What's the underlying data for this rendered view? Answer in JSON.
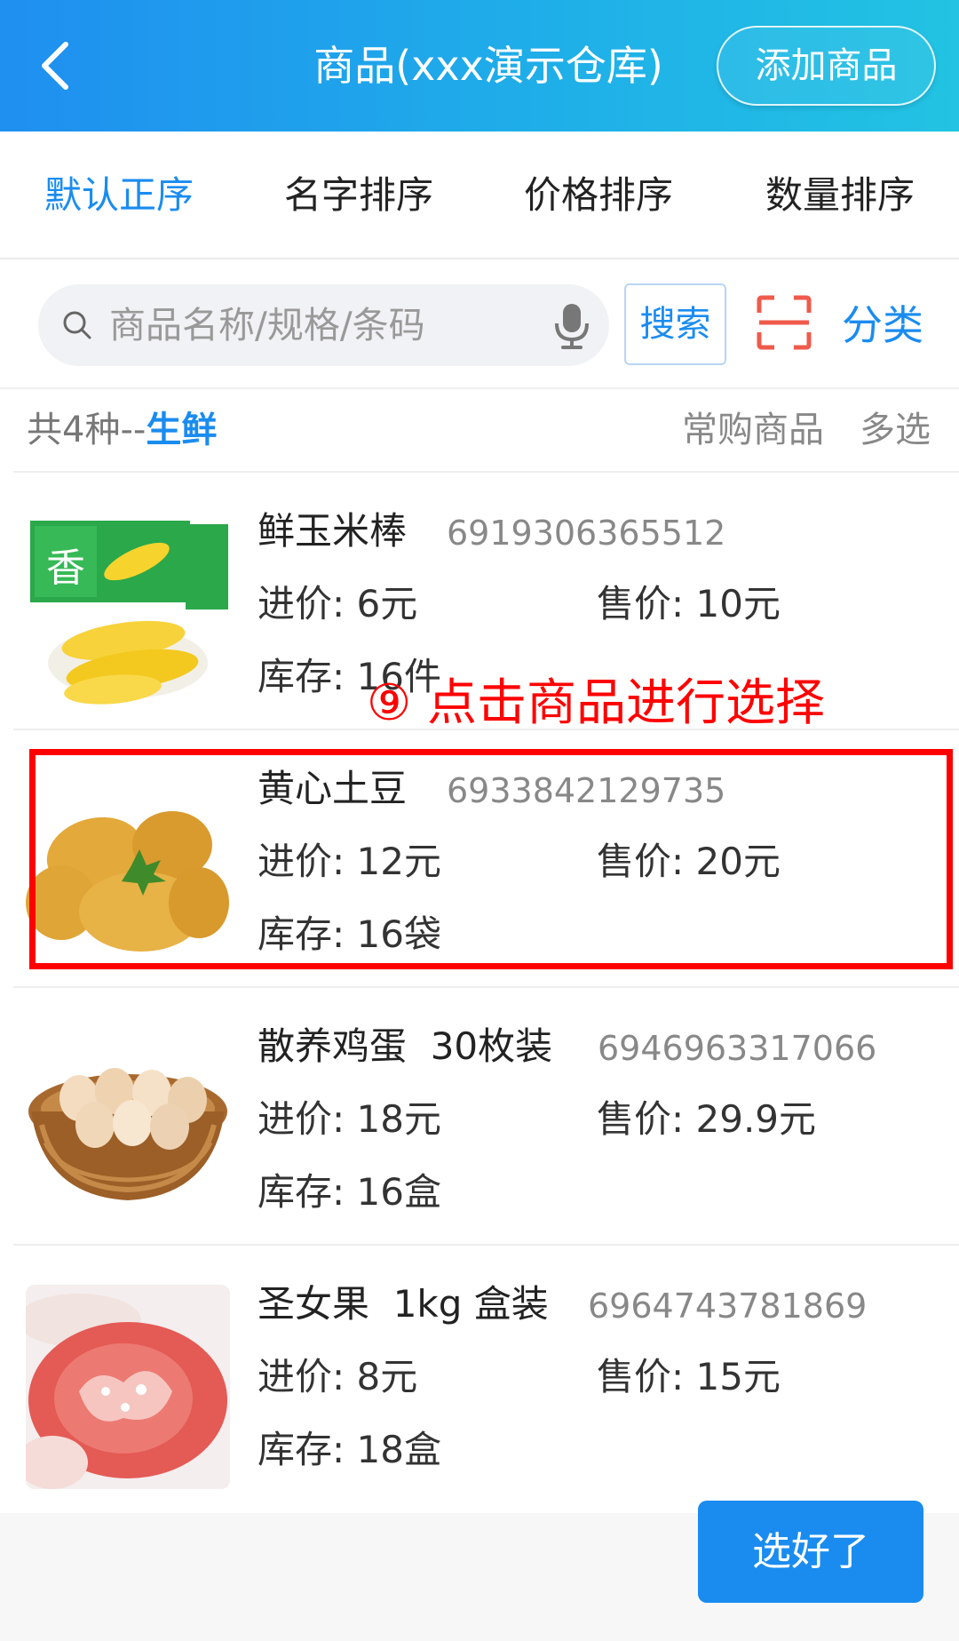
{
  "header": {
    "title": "商品(xxx演示仓库)",
    "add_label": "添加商品",
    "colors": {
      "start": "#1f8ff0",
      "end": "#22c3e3"
    }
  },
  "sort_tabs": [
    {
      "label": "默认正序",
      "active": true
    },
    {
      "label": "名字排序",
      "active": false
    },
    {
      "label": "价格排序",
      "active": false
    },
    {
      "label": "数量排序",
      "active": false
    }
  ],
  "search": {
    "placeholder": "商品名称/规格/条码",
    "button_label": "搜索",
    "category_label": "分类"
  },
  "info": {
    "count_text": "共4种--",
    "category": "生鲜",
    "frequent_label": "常购商品",
    "multi_label": "多选"
  },
  "products": [
    {
      "name": "鲜玉米棒",
      "code": "6919306365512",
      "buy": "进价: 6元",
      "sell": "售价: 10元",
      "stock": "库存: 16件",
      "image": "corn-image"
    },
    {
      "name": "黄心土豆",
      "code": "6933842129735",
      "buy": "进价: 12元",
      "sell": "售价: 20元",
      "stock": "库存: 16袋",
      "image": "potato-image"
    },
    {
      "name": "散养鸡蛋  30枚装",
      "code": "6946963317066",
      "buy": "进价: 18元",
      "sell": "售价: 29.9元",
      "stock": "库存: 16盒",
      "image": "eggs-image"
    },
    {
      "name": "圣女果  1kg 盒装",
      "code": "6964743781869",
      "buy": "进价: 8元",
      "sell": "售价: 15元",
      "stock": "库存: 18盒",
      "image": "tomato-image"
    }
  ],
  "annotation": {
    "text": "⑨ 点击商品进行选择",
    "color": "#ff0000"
  },
  "footer": {
    "done_label": "选好了"
  },
  "accent_color": "#1a8cf0"
}
